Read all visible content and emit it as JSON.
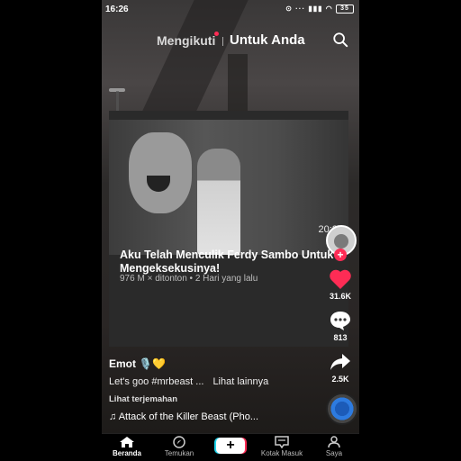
{
  "status_bar": {
    "time": "16:26",
    "icons": "⊙ ··· ▮▮▮ ◠",
    "battery": "35"
  },
  "top_nav": {
    "following_label": "Mengikuti",
    "for_you_label": "Untuk Anda"
  },
  "video_card": {
    "duration": "20:22",
    "title": "Aku Telah Menculik Ferdy Sambo Untuk Mengeksekusinya!",
    "meta": "976 M × ditonton • 2 Hari yang lalu"
  },
  "rail": {
    "likes": "31.6K",
    "comments": "813",
    "shares": "2.5K"
  },
  "post": {
    "author": "Emot 🎙️💛",
    "caption": "Let's goo #mrbeast ...",
    "see_more": "Lihat lainnya",
    "translate": "Lihat terjemahan",
    "music": "♫ Attack of the Killer Beast (Pho..."
  },
  "bottom_nav": {
    "home": "Beranda",
    "discover": "Temukan",
    "inbox": "Kotak Masuk",
    "profile": "Saya"
  },
  "colors": {
    "accent": "#fe2c55",
    "cyan": "#20d5ec"
  }
}
